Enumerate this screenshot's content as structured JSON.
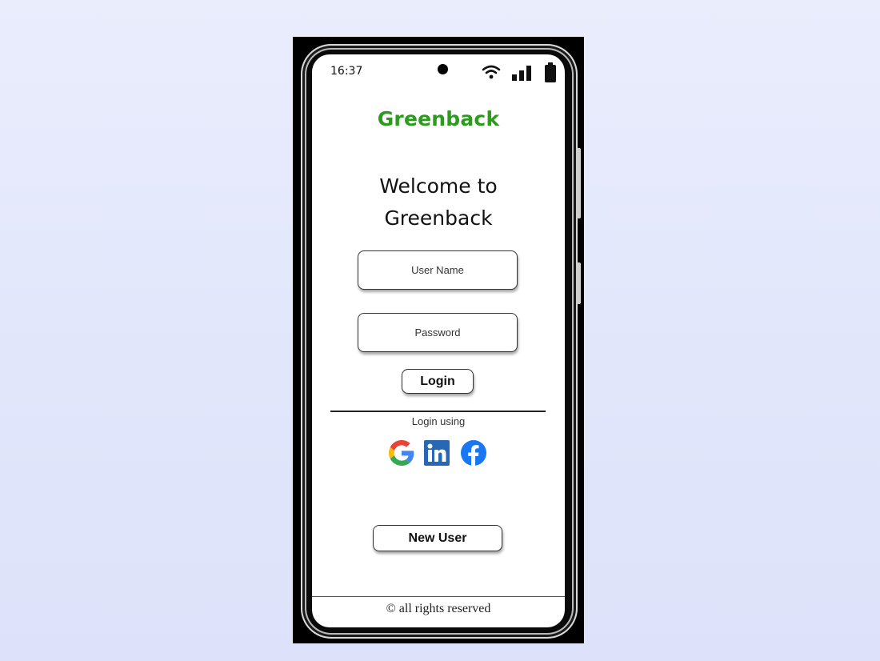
{
  "status_bar": {
    "time": "16:37",
    "icons": [
      "wifi-icon",
      "signal-icon",
      "battery-icon"
    ]
  },
  "app": {
    "title": "Greenback",
    "brand_color": "#2c9b1e"
  },
  "welcome": {
    "line1": "Welcome to",
    "line2": "Greenback"
  },
  "form": {
    "username_placeholder": "User Name",
    "password_placeholder": "Password",
    "login_label": "Login"
  },
  "social_login": {
    "label": "Login using",
    "providers": [
      "google-icon",
      "linkedin-icon",
      "facebook-icon"
    ]
  },
  "new_user_label": "New User",
  "footer": {
    "text": "© all rights reserved"
  }
}
